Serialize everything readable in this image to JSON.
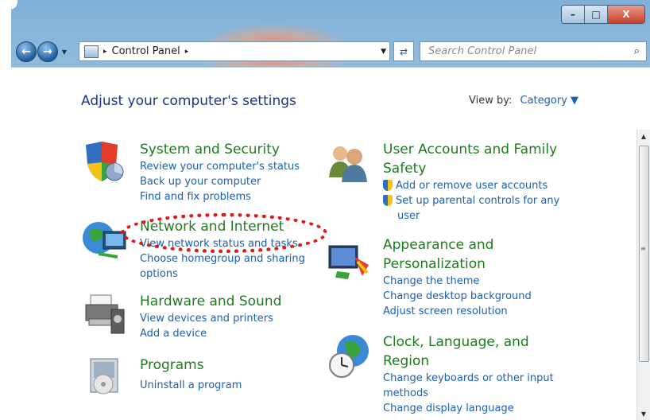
{
  "window": {
    "caption_buttons": {
      "minimize": "–",
      "maximize": "□",
      "close": "X"
    }
  },
  "address_bar": {
    "back_glyph": "←",
    "forward_glyph": "→",
    "breadcrumb": "Control Panel",
    "separator_glyph": "▸",
    "dropdown_glyph": "▼",
    "refresh_glyph": "⇄"
  },
  "search": {
    "placeholder": "Search Control Panel",
    "icon_glyph": "⌕"
  },
  "header": {
    "title": "Adjust your computer's settings",
    "view_by_label": "View by:",
    "view_by_value": "Category",
    "view_by_arrow": "▼"
  },
  "categories": {
    "system_security": {
      "title": "System and Security",
      "links": [
        "Review your computer's status",
        "Back up your computer",
        "Find and fix problems"
      ]
    },
    "network_internet": {
      "title": "Network and Internet",
      "links": [
        "View network status and tasks",
        "Choose homegroup and sharing",
        "options"
      ]
    },
    "hardware_sound": {
      "title": "Hardware and Sound",
      "links": [
        "View devices and printers",
        "Add a device"
      ]
    },
    "programs": {
      "title": "Programs",
      "links": [
        "Uninstall a program"
      ]
    },
    "user_accounts": {
      "title_line1": "User Accounts and Family",
      "title_line2": "Safety",
      "links": [
        "Add or remove user accounts",
        "Set up parental controls for any",
        "user"
      ]
    },
    "appearance": {
      "title_line1": "Appearance and",
      "title_line2": "Personalization",
      "links": [
        "Change the theme",
        "Change desktop background",
        "Adjust screen resolution"
      ]
    },
    "clock_language": {
      "title_line1": "Clock, Language, and",
      "title_line2": "Region",
      "links": [
        "Change keyboards or other input",
        "methods",
        "Change display language"
      ]
    }
  },
  "scrollbar": {
    "up": "▲",
    "down": "▼",
    "grip": "≡"
  },
  "colors": {
    "title_green": "#1e7a1e",
    "link_blue": "#1b5fb0",
    "highlight_red": "#e01818"
  }
}
